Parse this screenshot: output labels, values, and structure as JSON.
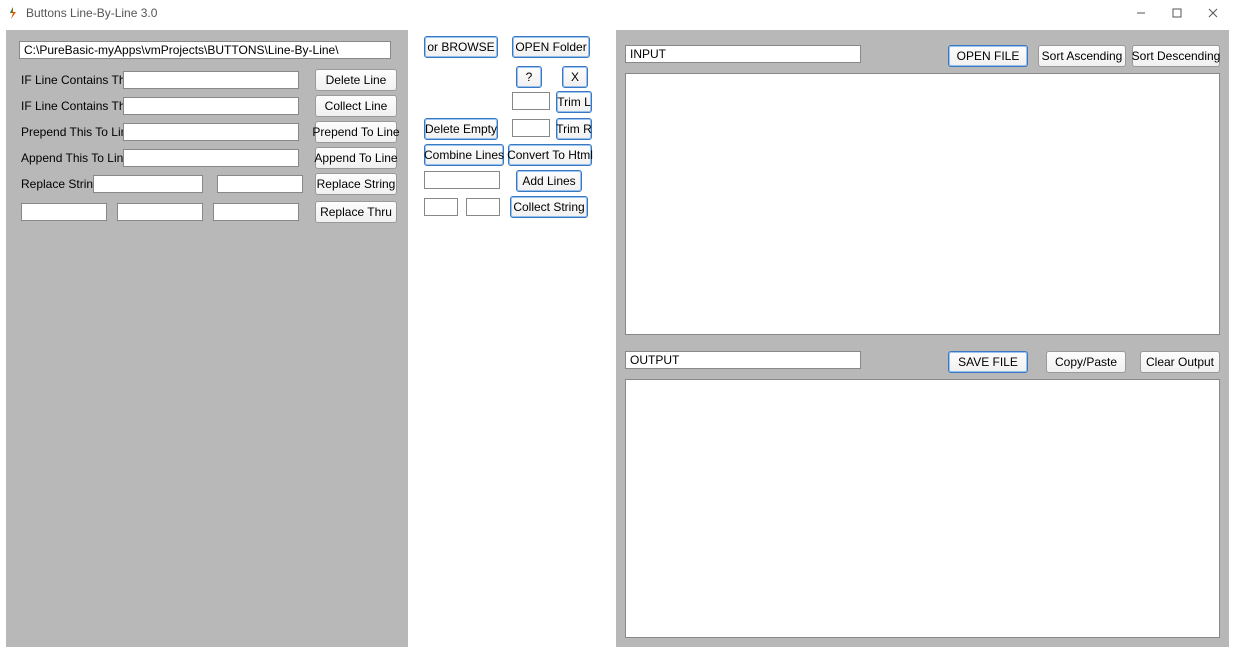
{
  "window": {
    "title": "Buttons  Line-By-Line  3.0"
  },
  "left": {
    "path_value": "C:\\PureBasic-myApps\\vmProjects\\BUTTONS\\Line-By-Line\\",
    "rows": {
      "delete": {
        "label": "IF Line Contains This:",
        "btn": "Delete Line"
      },
      "collect": {
        "label": "IF Line Contains This:",
        "btn": "Collect Line"
      },
      "prepend": {
        "label": "Prepend This To Line:",
        "btn": "Prepend To Line"
      },
      "append": {
        "label": "Append This To Line:",
        "btn": "Append To Line"
      },
      "replace": {
        "label": "Replace String:",
        "btn": "Replace String"
      },
      "thru": {
        "btn": "Replace Thru"
      }
    }
  },
  "mid": {
    "browse": "or  BROWSE",
    "open_folder": "OPEN Folder",
    "qmark": "?",
    "x": "X",
    "triml": "Trim L",
    "delete_empty": "Delete Empty",
    "trimr": "Trim R",
    "combine": "Combine Lines",
    "to_html": "Convert To Html",
    "add_lines": "Add Lines",
    "collect_string": "Collect String"
  },
  "right": {
    "input_label": "INPUT",
    "open_file": "OPEN FILE",
    "sort_asc": "Sort Ascending",
    "sort_desc": "Sort Descending",
    "output_label": "OUTPUT",
    "save_file": "SAVE FILE",
    "copy_paste": "Copy/Paste",
    "clear_output": "Clear Output"
  }
}
